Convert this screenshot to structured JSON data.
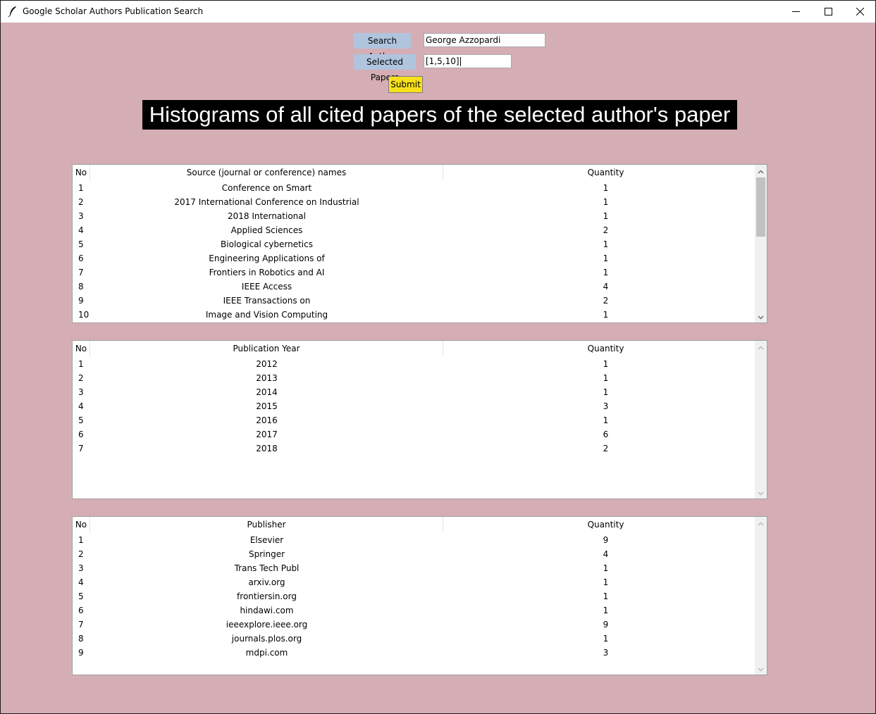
{
  "window": {
    "title": "Google Scholar Authors Publication Search",
    "icon": "feather-icon"
  },
  "form": {
    "author_label": "Search Author",
    "author_value": "George Azzopardi",
    "papers_label": "Selected Papers",
    "papers_value": "[1,5,10]",
    "submit_label": "Submit"
  },
  "heading": "Histograms of all cited papers of the selected author's paper",
  "colors": {
    "background": "#d5aeb5",
    "label_bg": "#b0c4de",
    "submit_bg": "#f8e11a",
    "heading_bg": "#000000",
    "heading_fg": "#ffffff"
  },
  "tables": {
    "sources": {
      "columns": [
        "No",
        "Source (journal or conference) names",
        "Quantity"
      ],
      "rows": [
        [
          "1",
          "Conference on Smart",
          "1"
        ],
        [
          "2",
          "2017 International Conference on Industrial",
          "1"
        ],
        [
          "3",
          "2018 International",
          "1"
        ],
        [
          "4",
          "Applied Sciences",
          "2"
        ],
        [
          "5",
          "Biological cybernetics",
          "1"
        ],
        [
          "6",
          "Engineering Applications of",
          "1"
        ],
        [
          "7",
          "Frontiers in Robotics and AI",
          "1"
        ],
        [
          "8",
          "IEEE Access",
          "4"
        ],
        [
          "9",
          "IEEE Transactions on",
          "2"
        ],
        [
          "10",
          "Image and Vision Computing",
          "1"
        ]
      ],
      "scroll_visible_fraction": 0.41,
      "scrollable": true
    },
    "years": {
      "columns": [
        "No",
        "Publication Year",
        "Quantity"
      ],
      "rows": [
        [
          "1",
          "2012",
          "1"
        ],
        [
          "2",
          "2013",
          "1"
        ],
        [
          "3",
          "2014",
          "1"
        ],
        [
          "4",
          "2015",
          "3"
        ],
        [
          "5",
          "2016",
          "1"
        ],
        [
          "6",
          "2017",
          "6"
        ],
        [
          "7",
          "2018",
          "2"
        ]
      ],
      "scrollable": false
    },
    "publishers": {
      "columns": [
        "No",
        "Publisher",
        "Quantity"
      ],
      "rows": [
        [
          "1",
          "Elsevier",
          "9"
        ],
        [
          "2",
          "Springer",
          "4"
        ],
        [
          "3",
          "Trans Tech Publ",
          "1"
        ],
        [
          "4",
          "arxiv.org",
          "1"
        ],
        [
          "5",
          "frontiersin.org",
          "1"
        ],
        [
          "6",
          "hindawi.com",
          "1"
        ],
        [
          "7",
          "ieeexplore.ieee.org",
          "9"
        ],
        [
          "8",
          "journals.plos.org",
          "1"
        ],
        [
          "9",
          "mdpi.com",
          "3"
        ]
      ],
      "scrollable": false
    }
  }
}
